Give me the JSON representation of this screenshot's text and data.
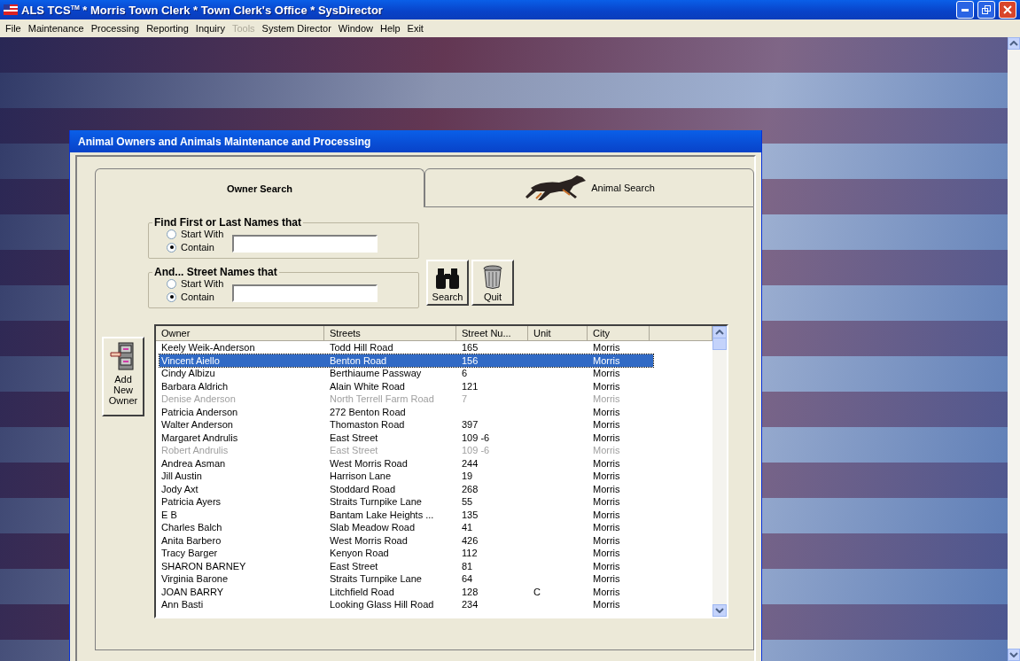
{
  "window": {
    "title": "ALS TCS$^{TM}$ * Morris Town Clerk * Town Clerk's Office * SysDirector"
  },
  "menu": [
    {
      "label": "File",
      "disabled": false
    },
    {
      "label": "Maintenance",
      "disabled": false
    },
    {
      "label": "Processing",
      "disabled": false
    },
    {
      "label": "Reporting",
      "disabled": false
    },
    {
      "label": "Inquiry",
      "disabled": false
    },
    {
      "label": "Tools",
      "disabled": true
    },
    {
      "label": "System Director",
      "disabled": false
    },
    {
      "label": "Window",
      "disabled": false
    },
    {
      "label": "Help",
      "disabled": false
    },
    {
      "label": "Exit",
      "disabled": false
    }
  ],
  "dialog": {
    "title": "Animal Owners and Animals Maintenance and Processing",
    "tabs": [
      {
        "label": "Owner Search",
        "selected": true,
        "kind": "plain"
      },
      {
        "label": "Animal Search",
        "selected": false,
        "kind": "dog"
      }
    ],
    "filters": [
      {
        "legend": "Find First or Last Names that",
        "options": [
          {
            "label": "Start With",
            "selected": false
          },
          {
            "label": "Contain",
            "selected": true
          }
        ]
      },
      {
        "legend": "And... Street Names that",
        "options": [
          {
            "label": "Start With",
            "selected": false
          },
          {
            "label": "Contain",
            "selected": true
          }
        ]
      }
    ],
    "buttons": [
      {
        "label": "Search",
        "kind": "search"
      },
      {
        "label": "Quit",
        "kind": "quit"
      }
    ],
    "add_button": {
      "label": "Add New Owner"
    },
    "table": {
      "columns": [
        "Owner",
        "Streets",
        "Street Nu...",
        "Unit",
        "City"
      ],
      "rows": [
        {
          "cells": [
            "Keely  Weik-Anderson",
            "Todd Hill Road",
            "165",
            null,
            "Morris"
          ],
          "selected": false,
          "disabled": false
        },
        {
          "cells": [
            "Vincent Aiello",
            "Benton Road",
            "156",
            null,
            "Morris"
          ],
          "selected": true,
          "disabled": false
        },
        {
          "cells": [
            "Cindy Albizu",
            "Berthiaume Passway",
            "6",
            null,
            "Morris"
          ],
          "selected": false,
          "disabled": false
        },
        {
          "cells": [
            "Barbara Aldrich",
            "Alain White Road",
            "121",
            null,
            "Morris"
          ],
          "selected": false,
          "disabled": false
        },
        {
          "cells": [
            "Denise Anderson",
            "North Terrell Farm Road",
            "7",
            null,
            "Morris"
          ],
          "selected": false,
          "disabled": true
        },
        {
          "cells": [
            "Patricia Anderson",
            "272 Benton Road",
            null,
            null,
            "Morris"
          ],
          "selected": false,
          "disabled": false
        },
        {
          "cells": [
            "Walter Anderson",
            "Thomaston Road",
            "397",
            null,
            "Morris"
          ],
          "selected": false,
          "disabled": false
        },
        {
          "cells": [
            "Margaret Andrulis",
            "East Street",
            "109 -6",
            null,
            "Morris"
          ],
          "selected": false,
          "disabled": false
        },
        {
          "cells": [
            "Robert Andrulis",
            "East Street",
            "109 -6",
            null,
            "Morris"
          ],
          "selected": false,
          "disabled": true
        },
        {
          "cells": [
            "Andrea Asman",
            "West Morris Road",
            "244",
            null,
            "Morris"
          ],
          "selected": false,
          "disabled": false
        },
        {
          "cells": [
            "Jill Austin",
            "Harrison Lane",
            "19",
            null,
            "Morris"
          ],
          "selected": false,
          "disabled": false
        },
        {
          "cells": [
            "Jody  Axt",
            "Stoddard Road",
            "268",
            null,
            "Morris"
          ],
          "selected": false,
          "disabled": false
        },
        {
          "cells": [
            "Patricia Ayers",
            "Straits Turnpike Lane",
            "55",
            null,
            "Morris"
          ],
          "selected": false,
          "disabled": false
        },
        {
          "cells": [
            "E B",
            "Bantam Lake Heights ...",
            "135",
            null,
            "Morris"
          ],
          "selected": false,
          "disabled": false
        },
        {
          "cells": [
            "Charles Balch",
            "Slab Meadow Road",
            "41",
            null,
            "Morris"
          ],
          "selected": false,
          "disabled": false
        },
        {
          "cells": [
            "Anita Barbero",
            "West Morris Road",
            "426",
            null,
            "Morris"
          ],
          "selected": false,
          "disabled": false
        },
        {
          "cells": [
            "Tracy Barger",
            "Kenyon Road",
            "112",
            null,
            "Morris"
          ],
          "selected": false,
          "disabled": false
        },
        {
          "cells": [
            "SHARON BARNEY",
            "East Street",
            "81",
            null,
            "Morris"
          ],
          "selected": false,
          "disabled": false
        },
        {
          "cells": [
            "Virginia Barone",
            "Straits Turnpike Lane",
            "64",
            null,
            "Morris"
          ],
          "selected": false,
          "disabled": false
        },
        {
          "cells": [
            "JOAN BARRY",
            "Litchfield Road",
            "128",
            "C",
            "Morris"
          ],
          "selected": false,
          "disabled": false
        },
        {
          "cells": [
            "Ann Basti",
            "Looking Glass Hill Road",
            "234",
            null,
            "Morris"
          ],
          "selected": false,
          "disabled": false
        }
      ]
    }
  }
}
